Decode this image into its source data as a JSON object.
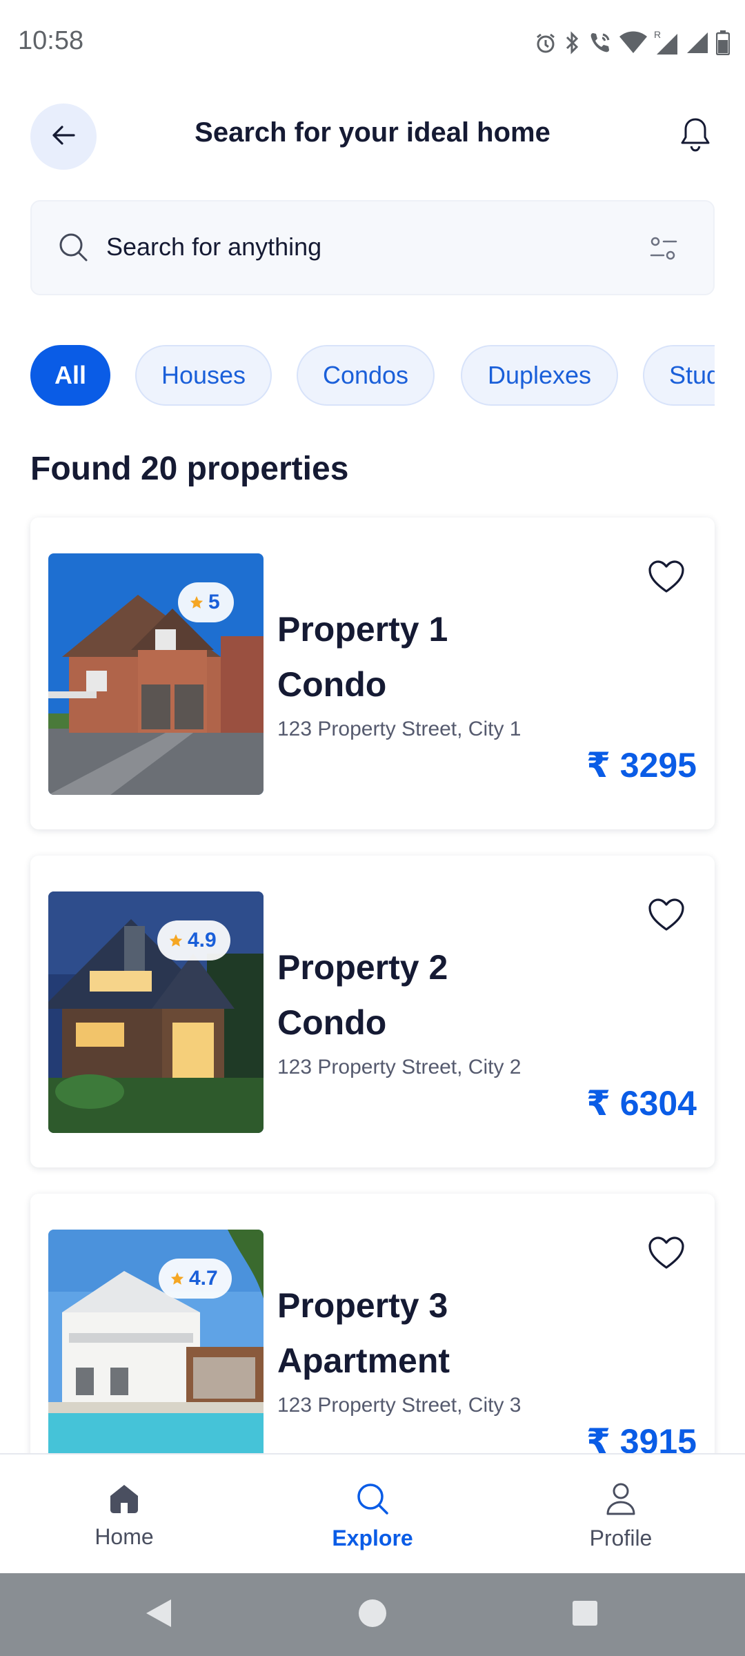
{
  "status_bar": {
    "time": "10:58",
    "icons": [
      "alarm-icon",
      "bluetooth-icon",
      "wifi-calling-icon",
      "wifi-icon",
      "signal-roaming-icon",
      "signal-icon",
      "battery-icon"
    ]
  },
  "header": {
    "title": "Search for your ideal home",
    "back_icon": "arrow-left-icon",
    "notification_icon": "bell-icon"
  },
  "search": {
    "placeholder": "Search for anything",
    "value": "",
    "filter_icon": "filter-sliders-icon"
  },
  "categories": [
    {
      "label": "All",
      "selected": true
    },
    {
      "label": "Houses",
      "selected": false
    },
    {
      "label": "Condos",
      "selected": false
    },
    {
      "label": "Duplexes",
      "selected": false
    },
    {
      "label": "Studios",
      "selected": false
    }
  ],
  "results_title": "Found 20 properties",
  "properties": [
    {
      "name": "Property 1",
      "type": "Condo",
      "address": "123 Property Street, City 1",
      "price": "₹ 3295",
      "rating": "5"
    },
    {
      "name": "Property 2",
      "type": "Condo",
      "address": "123 Property Street, City 2",
      "price": "₹ 6304",
      "rating": "4.9"
    },
    {
      "name": "Property 3",
      "type": "Apartment",
      "address": "123 Property Street, City 3",
      "price": "₹ 3915",
      "rating": "4.7"
    }
  ],
  "bottom_nav": [
    {
      "label": "Home",
      "icon": "home-icon",
      "active": false
    },
    {
      "label": "Explore",
      "icon": "search-icon",
      "active": true
    },
    {
      "label": "Profile",
      "icon": "user-icon",
      "active": false
    }
  ],
  "colors": {
    "accent": "#0a5ce6",
    "text_dark": "#151a33",
    "chip_bg": "#eef3fd",
    "star": "#f5a623"
  }
}
